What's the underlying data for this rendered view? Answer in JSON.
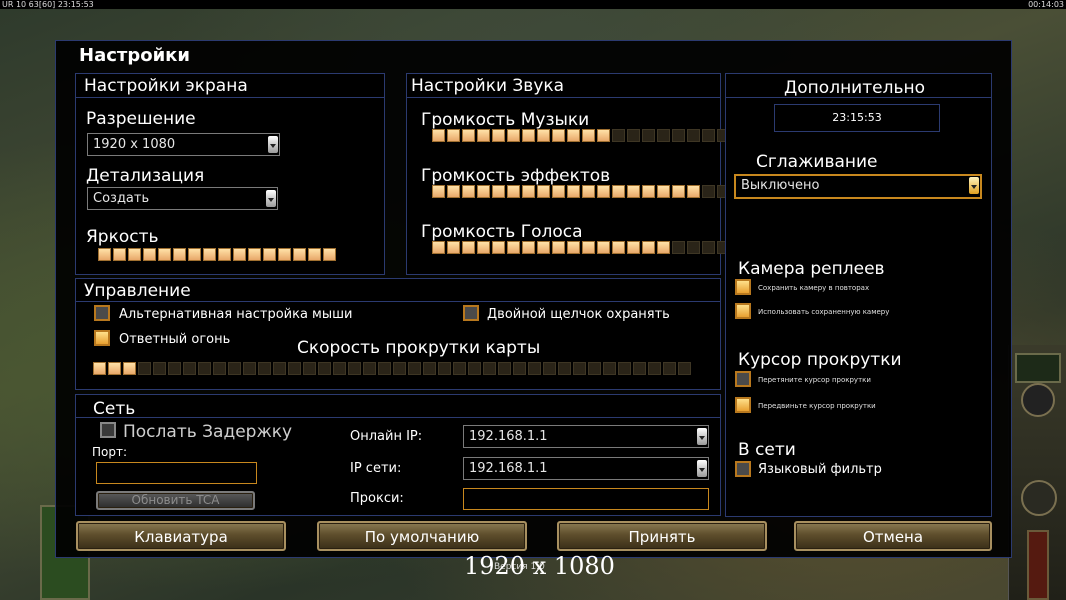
{
  "topbar": {
    "left": "UR 10 63[60] 23:15:53",
    "right": "00:14:03"
  },
  "dialog": {
    "title": "Настройки"
  },
  "screen": {
    "title": "Настройки экрана",
    "resolution_label": "Разрешение",
    "resolution_value": "1920 x 1080",
    "detail_label": "Детализация",
    "detail_value": "Создать",
    "brightness_label": "Яркость",
    "brightness_level": "16 of 16"
  },
  "sound": {
    "title": "Настройки Звука",
    "music_label": "Громкость Музыки",
    "music_level": "12 of 20",
    "effects_label": "Громкость эффектов",
    "effects_level": "18 of 20",
    "voice_label": "Громкость Голоса",
    "voice_level": "16 of 20"
  },
  "extra": {
    "title": "Дополнительно",
    "clock": "23:15:53",
    "antialias_label": "Сглаживание",
    "antialias_value": "Выключено",
    "replay_camera_label": "Камера реплеев",
    "replay_opt1": "Сохранить камеру в повторах",
    "replay_opt2": "Использовать сохраненную камеру",
    "scroll_cursor_label": "Курсор прокрутки",
    "scroll_opt1": "Перетяните курсор прокрутки",
    "scroll_opt2": "Передвиньте курсор прокрутки",
    "online_label": "В сети",
    "lang_filter": "Языковый фильтр"
  },
  "control": {
    "title": "Управление",
    "alt_mouse": "Альтернативная настройка мыши",
    "double_click": "Двойной щелчок охранять",
    "return_fire": "Ответный огонь",
    "scroll_speed_label": "Скорость прокрутки карты",
    "scroll_speed_level": "3 of 40"
  },
  "network": {
    "title": "Сеть",
    "send_delay": "Послать Задержку",
    "port_label": "Порт:",
    "port_value": "",
    "update_tca": "Обновить TCA",
    "online_ip_label": "Онлайн IP:",
    "online_ip_value": "192.168.1.1",
    "lan_ip_label": "IP сети:",
    "lan_ip_value": "192.168.1.1",
    "proxy_label": "Прокси:",
    "proxy_value": ""
  },
  "buttons": {
    "keyboard": "Клавиатура",
    "defaults": "По умолчанию",
    "accept": "Принять",
    "cancel": "Отмена"
  },
  "footer": {
    "version": "Версия 1.0",
    "resolution": "1920 x 1080"
  },
  "colors": {
    "accent": "#c8881e",
    "panel_border": "#2b3a70",
    "slider_on": "#f2c490"
  }
}
